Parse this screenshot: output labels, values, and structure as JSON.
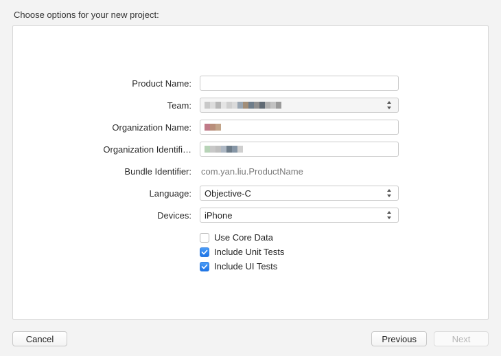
{
  "title": "Choose options for your new project:",
  "labels": {
    "product_name": "Product Name:",
    "team": "Team:",
    "org_name": "Organization Name:",
    "org_id": "Organization Identifi…",
    "bundle_id": "Bundle Identifier:",
    "language": "Language:",
    "devices": "Devices:"
  },
  "values": {
    "product_name": "",
    "team_selected": "",
    "org_name": "",
    "org_identifier": "",
    "bundle_identifier": "com.yan.liu.ProductName",
    "language_selected": "Objective-C",
    "devices_selected": "iPhone"
  },
  "checkboxes": {
    "core_data": {
      "label": "Use Core Data",
      "checked": false
    },
    "unit_tests": {
      "label": "Include Unit Tests",
      "checked": true
    },
    "ui_tests": {
      "label": "Include UI Tests",
      "checked": true
    }
  },
  "buttons": {
    "cancel": "Cancel",
    "previous": "Previous",
    "next": "Next"
  },
  "redacted": {
    "team_colors": [
      "#c9c9c9",
      "#dcdcdc",
      "#b7b7b7",
      "#e4e4e4",
      "#cfcfcf",
      "#dadada",
      "#9aa6b2",
      "#a28e78",
      "#6e7d8a",
      "#8f8f8f",
      "#606a74",
      "#b0b0b0",
      "#c2c2c2",
      "#9a9a9a"
    ],
    "org_name_colors": [
      "#c07a88",
      "#b98e7a",
      "#c2a489"
    ],
    "org_id_colors": [
      "#b7d3b7",
      "#c8c8c8",
      "#bfbfbf",
      "#aeb8c4",
      "#6e7d8a",
      "#8696a6",
      "#cfcfcf"
    ]
  }
}
